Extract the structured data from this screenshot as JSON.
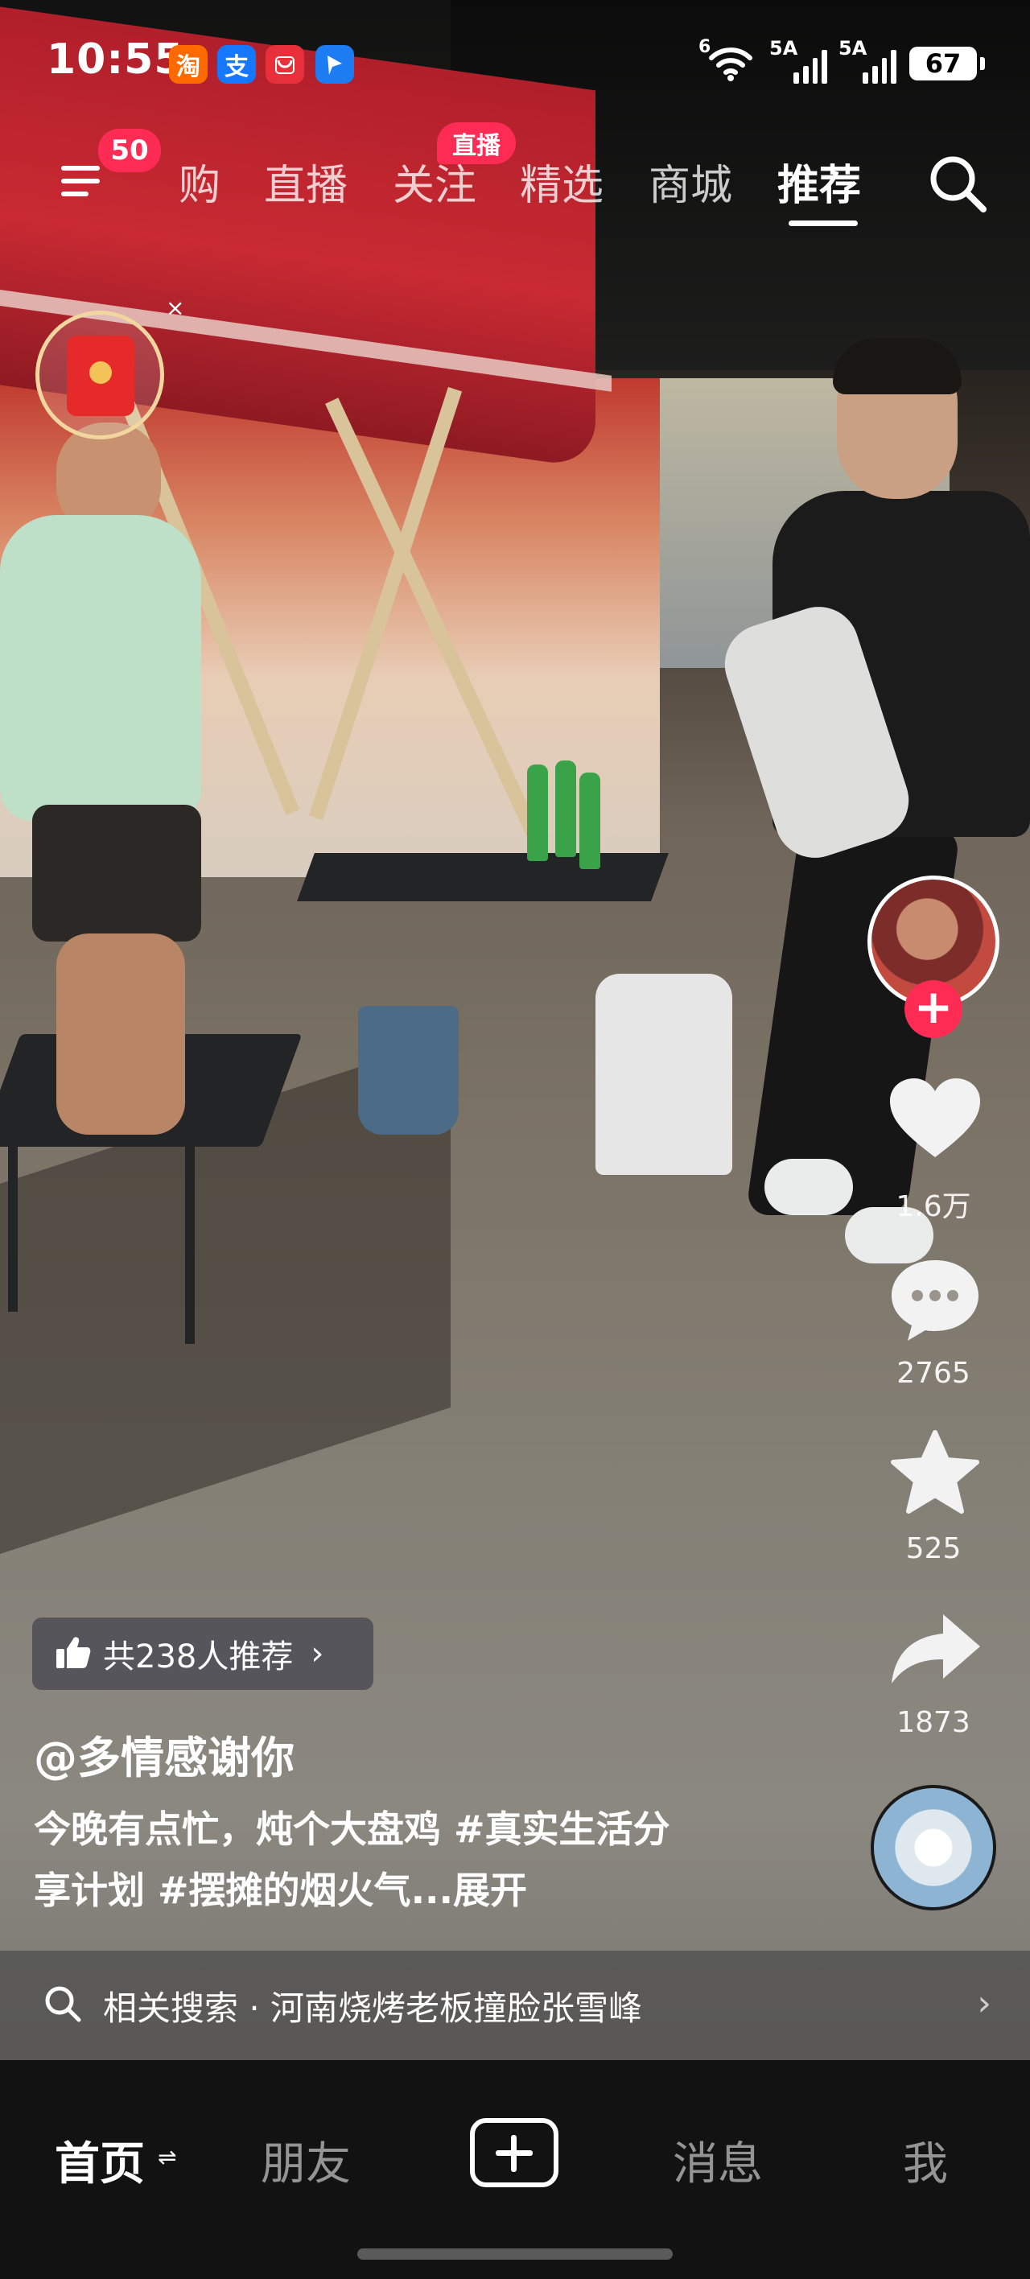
{
  "status_bar": {
    "time": "10:55",
    "apps": [
      {
        "icon": "taobao-icon",
        "glyph": "淘",
        "color": "#ff6a00"
      },
      {
        "icon": "alipay-icon",
        "glyph": "支",
        "color": "#1677ff"
      },
      {
        "icon": "appgallery-icon",
        "glyph": "",
        "color": "#e8303a"
      },
      {
        "icon": "feishu-icon",
        "glyph": "",
        "color": "#1e7cf2"
      }
    ],
    "wifi_label": "6",
    "signal1_label": "5A",
    "signal2_label": "5A",
    "battery": "67"
  },
  "top_nav": {
    "menu_badge": "50",
    "tabs": [
      {
        "label": "购"
      },
      {
        "label": "直播"
      },
      {
        "label": "关注",
        "badge": "直播"
      },
      {
        "label": "精选"
      },
      {
        "label": "商城"
      },
      {
        "label": "推荐",
        "active": true
      }
    ]
  },
  "red_packet": {
    "close": "×"
  },
  "actions": {
    "like_count": "1.6万",
    "comment_count": "2765",
    "favorite_count": "525",
    "share_count": "1873",
    "follow_glyph": "+"
  },
  "caption": {
    "recommend_text": "共238人推荐",
    "recommend_chevron": "›",
    "author": "@多情感谢你",
    "desc_line1_plain": "今晚有点忙，炖个大盘鸡 ",
    "desc_line1_tag": "#真实生活分",
    "desc_line2_tag1": "享计划 ",
    "desc_line2_tag2": "#摆摊的烟火气",
    "desc_more": "...展开"
  },
  "related_search": {
    "text": "相关搜索 · 河南烧烤老板撞脸张雪峰",
    "chevron": "›"
  },
  "bottom_nav": {
    "tabs": [
      {
        "label": "首页",
        "active": true
      },
      {
        "label": "朋友"
      },
      {
        "label": "消息"
      },
      {
        "label": "我"
      }
    ],
    "swap_glyph": "⇌"
  },
  "colors": {
    "accent": "#fe2c55",
    "background": "#121212"
  }
}
